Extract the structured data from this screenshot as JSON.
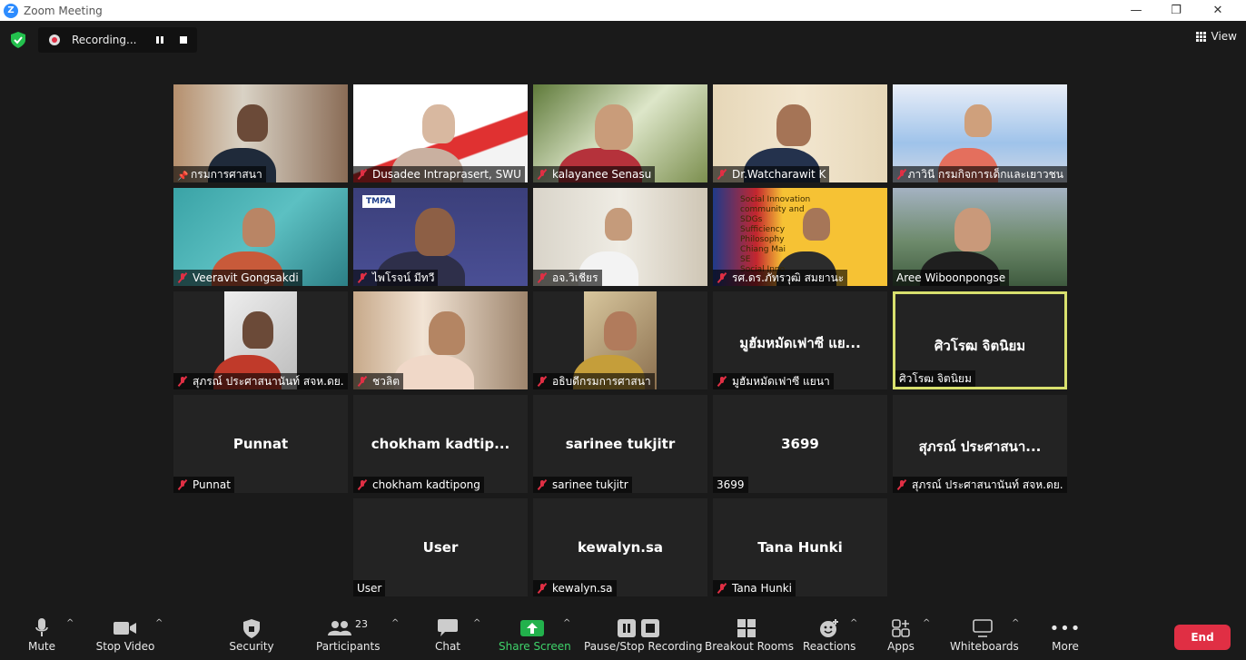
{
  "window": {
    "title": "Zoom Meeting",
    "minimize": "—",
    "maximize": "❐",
    "close": "✕"
  },
  "recording": {
    "label": "Recording...",
    "pause_icon": "pause-icon",
    "stop_icon": "stop-icon"
  },
  "view": {
    "label": "View"
  },
  "tiles": [
    {
      "name": "กรมการศาสนา",
      "mic": "pin"
    },
    {
      "name": "Dusadee Intraprasert, SWU",
      "mic": "muted"
    },
    {
      "name": "kalayanee Senasu",
      "mic": "muted"
    },
    {
      "name": "Dr.Watcharawit K",
      "mic": "muted"
    },
    {
      "name": "ภาวินี กรมกิจการเด็กและเยาวชน",
      "mic": "muted"
    },
    {
      "name": "Veeravit Gongsakdi",
      "mic": "muted"
    },
    {
      "name": "ไพโรจน์ มีทวี",
      "mic": "muted",
      "logo": "TMPA"
    },
    {
      "name": "อจ.วิเชียร",
      "mic": "muted"
    },
    {
      "name": "รศ.ดร.ภัทรวุฒิ สมยานะ",
      "mic": "muted",
      "slide": [
        "Social Innovation",
        "community and",
        "SDGs",
        "Sufficiency",
        "Philosophy",
        "Chiang Mai",
        "SE",
        "Social Inno"
      ]
    },
    {
      "name": "Aree Wiboonpongse",
      "mic": "none"
    },
    {
      "name": "สุภรณ์ ประศาสนานันท์ สจห.ดย.",
      "mic": "muted"
    },
    {
      "name": "ชวลิต",
      "mic": "muted"
    },
    {
      "name": "อธิบดีกรมการศาสนา",
      "mic": "muted"
    },
    {
      "name": "มูฮัมหมัดเฟาซี แยนา",
      "mic": "muted",
      "big": "มูฮัมหมัดเฟาซี แย..."
    },
    {
      "name": "ศิวโรฒ จิตนิยม",
      "mic": "none",
      "big": "ศิวโรฒ จิตนิยม"
    },
    {
      "name": "Punnat",
      "mic": "muted",
      "big": "Punnat"
    },
    {
      "name": "chokham kadtipong",
      "mic": "muted",
      "big": "chokham  kadtip..."
    },
    {
      "name": "sarinee tukjitr",
      "mic": "muted",
      "big": "sarinee tukjitr"
    },
    {
      "name": "3699",
      "mic": "none",
      "big": "3699"
    },
    {
      "name": "สุภรณ์ ประศาสนานันท์ สจห.ดย.",
      "mic": "muted",
      "big": "สุภรณ์ ประศาสนา..."
    },
    {
      "name": "User",
      "mic": "none",
      "big": "User"
    },
    {
      "name": "kewalyn.sa",
      "mic": "muted",
      "big": "kewalyn.sa"
    },
    {
      "name": "Tana Hunki",
      "mic": "muted",
      "big": "Tana Hunki"
    }
  ],
  "toolbar": {
    "mute": "Mute",
    "stop_video": "Stop Video",
    "security": "Security",
    "participants": "Participants",
    "participants_count": "23",
    "chat": "Chat",
    "share_screen": "Share Screen",
    "pause_stop_recording": "Pause/Stop Recording",
    "breakout_rooms": "Breakout Rooms",
    "reactions": "Reactions",
    "apps": "Apps",
    "whiteboards": "Whiteboards",
    "more": "More",
    "end": "End"
  },
  "colors": {
    "end": "#e02f44",
    "share": "#22b14c",
    "active_speaker": "#d8e06e",
    "muted": "#e02f44"
  }
}
